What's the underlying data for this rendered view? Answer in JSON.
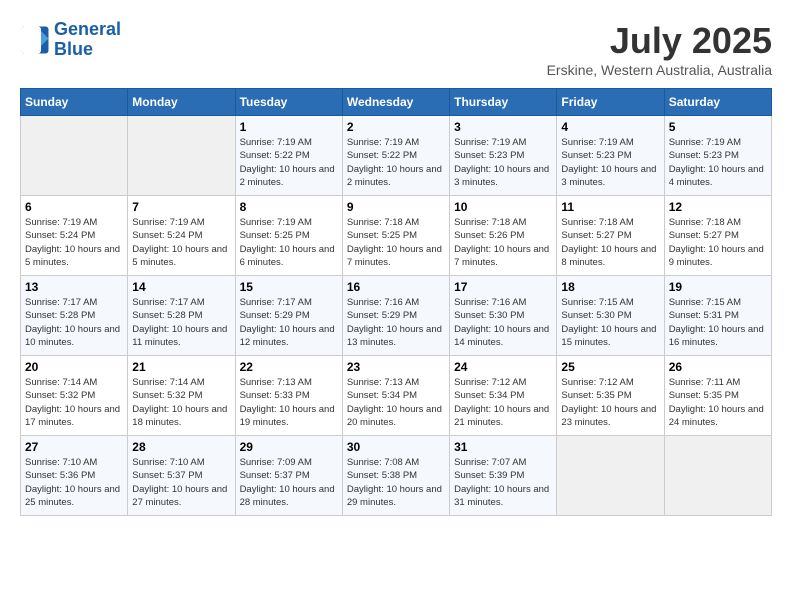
{
  "header": {
    "logo_line1": "General",
    "logo_line2": "Blue",
    "month": "July 2025",
    "location": "Erskine, Western Australia, Australia"
  },
  "weekdays": [
    "Sunday",
    "Monday",
    "Tuesday",
    "Wednesday",
    "Thursday",
    "Friday",
    "Saturday"
  ],
  "weeks": [
    [
      {
        "day": "",
        "sunrise": "",
        "sunset": "",
        "daylight": ""
      },
      {
        "day": "",
        "sunrise": "",
        "sunset": "",
        "daylight": ""
      },
      {
        "day": "1",
        "sunrise": "Sunrise: 7:19 AM",
        "sunset": "Sunset: 5:22 PM",
        "daylight": "Daylight: 10 hours and 2 minutes."
      },
      {
        "day": "2",
        "sunrise": "Sunrise: 7:19 AM",
        "sunset": "Sunset: 5:22 PM",
        "daylight": "Daylight: 10 hours and 2 minutes."
      },
      {
        "day": "3",
        "sunrise": "Sunrise: 7:19 AM",
        "sunset": "Sunset: 5:23 PM",
        "daylight": "Daylight: 10 hours and 3 minutes."
      },
      {
        "day": "4",
        "sunrise": "Sunrise: 7:19 AM",
        "sunset": "Sunset: 5:23 PM",
        "daylight": "Daylight: 10 hours and 3 minutes."
      },
      {
        "day": "5",
        "sunrise": "Sunrise: 7:19 AM",
        "sunset": "Sunset: 5:23 PM",
        "daylight": "Daylight: 10 hours and 4 minutes."
      }
    ],
    [
      {
        "day": "6",
        "sunrise": "Sunrise: 7:19 AM",
        "sunset": "Sunset: 5:24 PM",
        "daylight": "Daylight: 10 hours and 5 minutes."
      },
      {
        "day": "7",
        "sunrise": "Sunrise: 7:19 AM",
        "sunset": "Sunset: 5:24 PM",
        "daylight": "Daylight: 10 hours and 5 minutes."
      },
      {
        "day": "8",
        "sunrise": "Sunrise: 7:19 AM",
        "sunset": "Sunset: 5:25 PM",
        "daylight": "Daylight: 10 hours and 6 minutes."
      },
      {
        "day": "9",
        "sunrise": "Sunrise: 7:18 AM",
        "sunset": "Sunset: 5:25 PM",
        "daylight": "Daylight: 10 hours and 7 minutes."
      },
      {
        "day": "10",
        "sunrise": "Sunrise: 7:18 AM",
        "sunset": "Sunset: 5:26 PM",
        "daylight": "Daylight: 10 hours and 7 minutes."
      },
      {
        "day": "11",
        "sunrise": "Sunrise: 7:18 AM",
        "sunset": "Sunset: 5:27 PM",
        "daylight": "Daylight: 10 hours and 8 minutes."
      },
      {
        "day": "12",
        "sunrise": "Sunrise: 7:18 AM",
        "sunset": "Sunset: 5:27 PM",
        "daylight": "Daylight: 10 hours and 9 minutes."
      }
    ],
    [
      {
        "day": "13",
        "sunrise": "Sunrise: 7:17 AM",
        "sunset": "Sunset: 5:28 PM",
        "daylight": "Daylight: 10 hours and 10 minutes."
      },
      {
        "day": "14",
        "sunrise": "Sunrise: 7:17 AM",
        "sunset": "Sunset: 5:28 PM",
        "daylight": "Daylight: 10 hours and 11 minutes."
      },
      {
        "day": "15",
        "sunrise": "Sunrise: 7:17 AM",
        "sunset": "Sunset: 5:29 PM",
        "daylight": "Daylight: 10 hours and 12 minutes."
      },
      {
        "day": "16",
        "sunrise": "Sunrise: 7:16 AM",
        "sunset": "Sunset: 5:29 PM",
        "daylight": "Daylight: 10 hours and 13 minutes."
      },
      {
        "day": "17",
        "sunrise": "Sunrise: 7:16 AM",
        "sunset": "Sunset: 5:30 PM",
        "daylight": "Daylight: 10 hours and 14 minutes."
      },
      {
        "day": "18",
        "sunrise": "Sunrise: 7:15 AM",
        "sunset": "Sunset: 5:30 PM",
        "daylight": "Daylight: 10 hours and 15 minutes."
      },
      {
        "day": "19",
        "sunrise": "Sunrise: 7:15 AM",
        "sunset": "Sunset: 5:31 PM",
        "daylight": "Daylight: 10 hours and 16 minutes."
      }
    ],
    [
      {
        "day": "20",
        "sunrise": "Sunrise: 7:14 AM",
        "sunset": "Sunset: 5:32 PM",
        "daylight": "Daylight: 10 hours and 17 minutes."
      },
      {
        "day": "21",
        "sunrise": "Sunrise: 7:14 AM",
        "sunset": "Sunset: 5:32 PM",
        "daylight": "Daylight: 10 hours and 18 minutes."
      },
      {
        "day": "22",
        "sunrise": "Sunrise: 7:13 AM",
        "sunset": "Sunset: 5:33 PM",
        "daylight": "Daylight: 10 hours and 19 minutes."
      },
      {
        "day": "23",
        "sunrise": "Sunrise: 7:13 AM",
        "sunset": "Sunset: 5:34 PM",
        "daylight": "Daylight: 10 hours and 20 minutes."
      },
      {
        "day": "24",
        "sunrise": "Sunrise: 7:12 AM",
        "sunset": "Sunset: 5:34 PM",
        "daylight": "Daylight: 10 hours and 21 minutes."
      },
      {
        "day": "25",
        "sunrise": "Sunrise: 7:12 AM",
        "sunset": "Sunset: 5:35 PM",
        "daylight": "Daylight: 10 hours and 23 minutes."
      },
      {
        "day": "26",
        "sunrise": "Sunrise: 7:11 AM",
        "sunset": "Sunset: 5:35 PM",
        "daylight": "Daylight: 10 hours and 24 minutes."
      }
    ],
    [
      {
        "day": "27",
        "sunrise": "Sunrise: 7:10 AM",
        "sunset": "Sunset: 5:36 PM",
        "daylight": "Daylight: 10 hours and 25 minutes."
      },
      {
        "day": "28",
        "sunrise": "Sunrise: 7:10 AM",
        "sunset": "Sunset: 5:37 PM",
        "daylight": "Daylight: 10 hours and 27 minutes."
      },
      {
        "day": "29",
        "sunrise": "Sunrise: 7:09 AM",
        "sunset": "Sunset: 5:37 PM",
        "daylight": "Daylight: 10 hours and 28 minutes."
      },
      {
        "day": "30",
        "sunrise": "Sunrise: 7:08 AM",
        "sunset": "Sunset: 5:38 PM",
        "daylight": "Daylight: 10 hours and 29 minutes."
      },
      {
        "day": "31",
        "sunrise": "Sunrise: 7:07 AM",
        "sunset": "Sunset: 5:39 PM",
        "daylight": "Daylight: 10 hours and 31 minutes."
      },
      {
        "day": "",
        "sunrise": "",
        "sunset": "",
        "daylight": ""
      },
      {
        "day": "",
        "sunrise": "",
        "sunset": "",
        "daylight": ""
      }
    ]
  ]
}
